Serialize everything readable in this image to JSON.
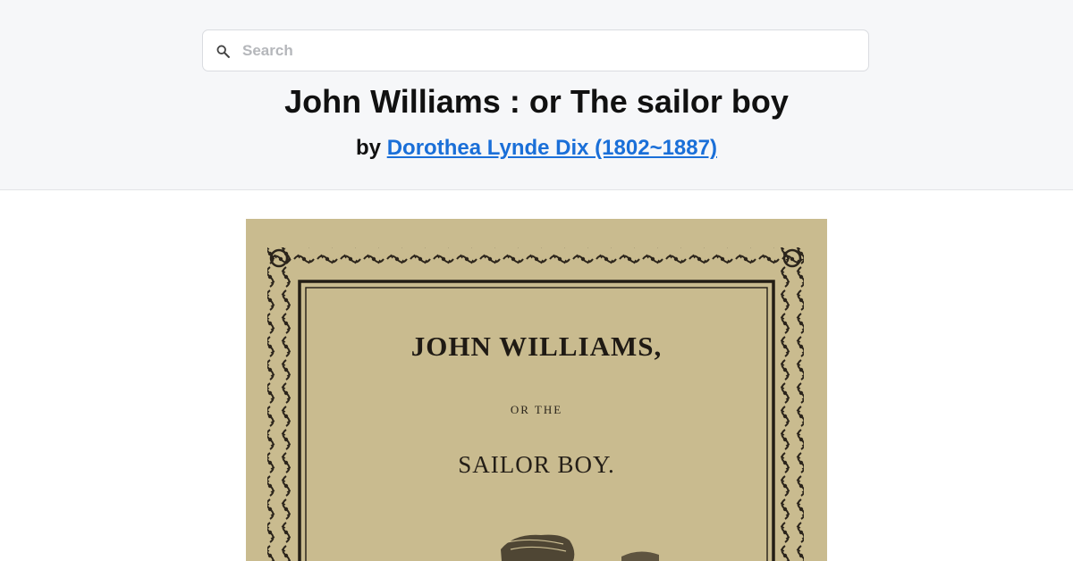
{
  "search": {
    "placeholder": "Search",
    "icon": "search-icon"
  },
  "book": {
    "title": "John Williams : or The sailor boy",
    "by_prefix": "by",
    "author": "Dorothea Lynde Dix (1802~1887)"
  },
  "cover": {
    "title_line": "JOHN WILLIAMS,",
    "connector": "OR THE",
    "subtitle": "SAILOR BOY."
  },
  "colors": {
    "header_bg": "#f6f7f9",
    "link": "#1a6fd8",
    "cover_paper": "#cdbf94"
  }
}
